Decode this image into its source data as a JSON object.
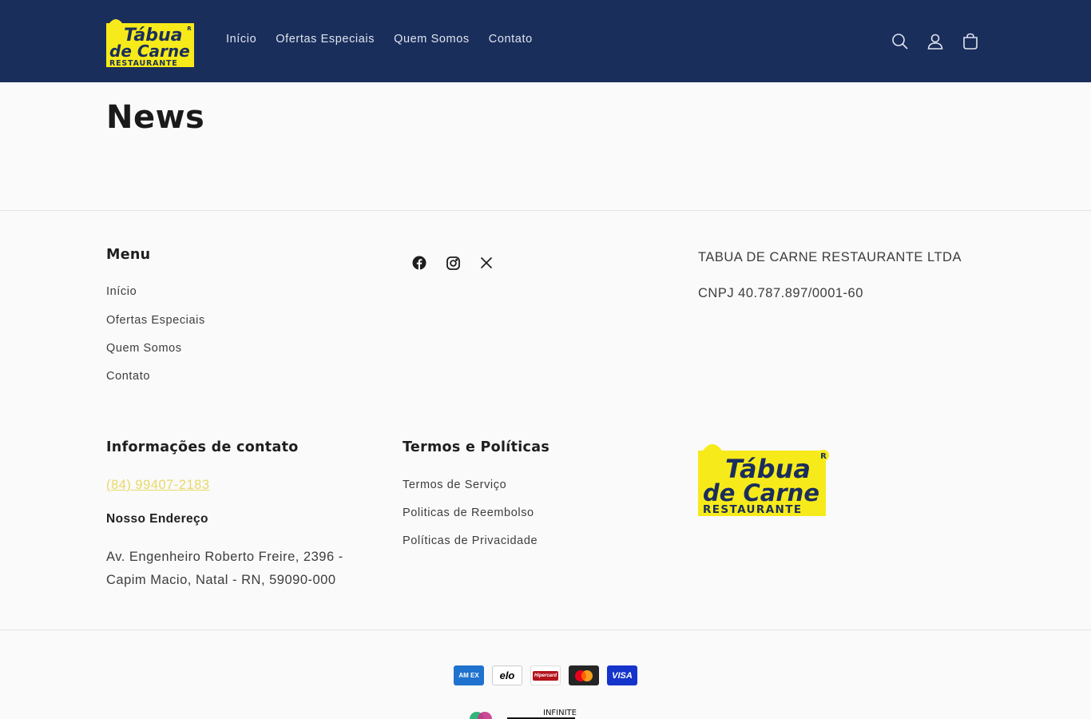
{
  "header": {
    "logo_alt": "Tábua de Carne Restaurante",
    "nav": [
      "Início",
      "Ofertas Especiais",
      "Quem Somos",
      "Contato"
    ],
    "icons": [
      "search-icon",
      "account-icon",
      "cart-icon"
    ]
  },
  "main": {
    "title": "News"
  },
  "footer": {
    "menu": {
      "heading": "Menu",
      "links": [
        "Início",
        "Ofertas Especiais",
        "Quem Somos",
        "Contato"
      ]
    },
    "social": [
      "facebook-icon",
      "instagram-icon",
      "x-icon"
    ],
    "company": {
      "name": "TABUA DE CARNE RESTAURANTE LTDA",
      "cnpj": "CNPJ 40.787.897/0001-60"
    },
    "contact": {
      "heading": "Informações de contato",
      "phone": "(84) 99407-2183",
      "address_label": "Nosso Endereço",
      "address": "Av. Engenheiro Roberto Freire, 2396 - Capim Macio, Natal - RN, 59090-000"
    },
    "policies": {
      "heading": "Termos e Políticas",
      "links": [
        "Termos de Serviço",
        "Politicas de Reembolso",
        "Políticas de Privacidade"
      ]
    },
    "payments": [
      "American Express",
      "Elo",
      "Hipercard",
      "Mastercard",
      "Visa"
    ],
    "payment_labels": {
      "amex": "AM EX",
      "elo": "elo",
      "hipercard": "Hipercard",
      "visa": "VISA"
    },
    "logo_text": {
      "top": "Tábua",
      "middle": "de Carne",
      "bottom": "RESTAURANTE"
    },
    "bottom_badge": "INFINITE"
  },
  "colors": {
    "header_bg": "#1a2e5c",
    "brand_yellow": "#f7ea1a",
    "phone_link": "#e8d96a"
  }
}
